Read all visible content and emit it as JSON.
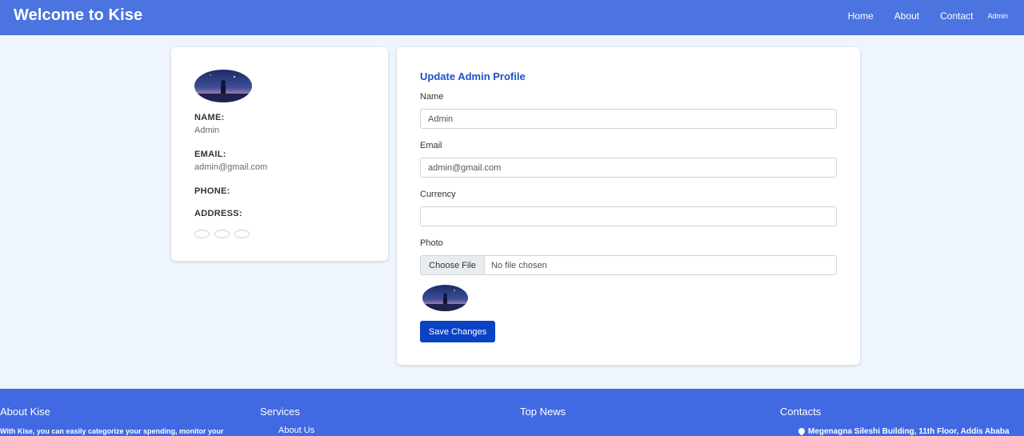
{
  "header": {
    "brand": "Welcome to Kise",
    "nav": [
      "Home",
      "About",
      "Contact",
      "Admin"
    ]
  },
  "profile": {
    "name_label": "NAME:",
    "name_value": "Admin",
    "email_label": "EMAIL:",
    "email_value": "admin@gmail.com",
    "phone_label": "PHONE:",
    "address_label": "ADDRESS:"
  },
  "form": {
    "title": "Update Admin Profile",
    "name_label": "Name",
    "name_value": "Admin",
    "email_label": "Email",
    "email_value": "admin@gmail.com",
    "currency_label": "Currency",
    "currency_value": "",
    "photo_label": "Photo",
    "file_button": "Choose File",
    "file_status": "No file chosen",
    "save_button": "Save Changes"
  },
  "footer": {
    "about_title": "About Kise",
    "about_text": "With Kise, you can easily categorize your spending, monitor your",
    "services_title": "Services",
    "services_first": "About Us",
    "news_title": "Top News",
    "contacts_title": "Contacts",
    "address": "Megenagna Sileshi Building, 11th Floor, Addis Ababa"
  },
  "colors": {
    "header": "#4b74e0",
    "footer": "#4169e1",
    "accent": "#0b43c4",
    "background": "#eef5fd"
  }
}
